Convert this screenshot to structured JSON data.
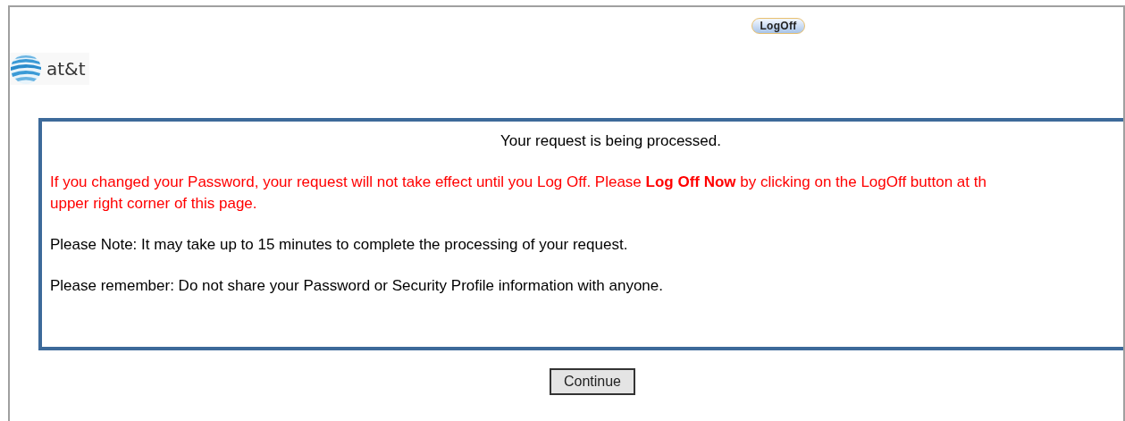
{
  "header": {
    "logoff_button": "LogOff",
    "logo_text": "at&t"
  },
  "message": {
    "title": "Your request is being processed.",
    "warning_lines": [
      "If you changed your Password, your request will not take effect until you Log Off. Please **Log Off Now** by clicking on the LogOff button at th",
      "upper right corner of this page."
    ],
    "notes": [
      "Please Note: It may take up to 15 minutes to complete the processing of your request.",
      "Please remember: Do not share your Password or Security Profile information with anyone."
    ]
  },
  "continue_button": "Continue"
}
